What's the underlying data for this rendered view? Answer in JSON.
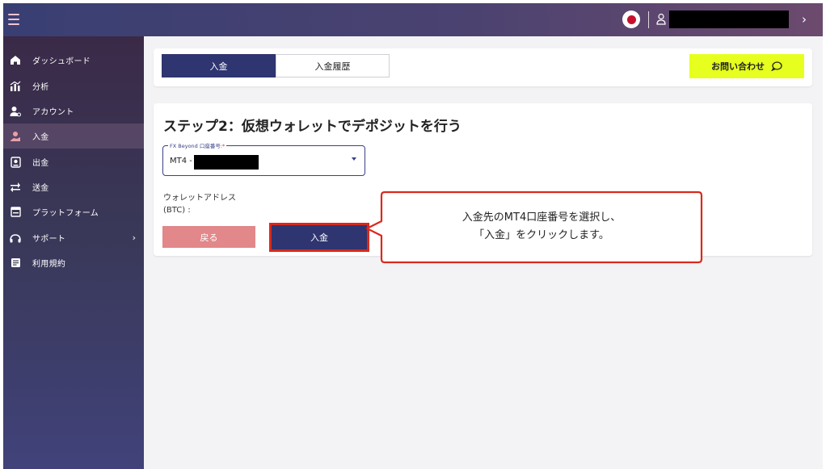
{
  "colors": {
    "navy": "#2e3570",
    "accent_yellow": "#e6ff1e",
    "back_button": "#e2878a",
    "highlight_red": "#d9291c"
  },
  "header": {
    "icons": [
      "menu-icon",
      "japan-flag-icon",
      "user-icon",
      "chevron-right-icon"
    ],
    "chevron": "›"
  },
  "sidebar": {
    "items": [
      {
        "label": "ダッシュボード",
        "icon": "home-icon"
      },
      {
        "label": "分析",
        "icon": "chart-icon"
      },
      {
        "label": "アカウント",
        "icon": "account-icon"
      },
      {
        "label": "入金",
        "icon": "deposit-icon",
        "active": true
      },
      {
        "label": "出金",
        "icon": "withdraw-icon"
      },
      {
        "label": "送金",
        "icon": "transfer-icon"
      },
      {
        "label": "プラットフォーム",
        "icon": "platform-icon"
      },
      {
        "label": "サポート",
        "icon": "support-icon",
        "caret": "›"
      },
      {
        "label": "利用規約",
        "icon": "terms-icon"
      }
    ]
  },
  "tabs": {
    "deposit": "入金",
    "history": "入金履歴",
    "contact": "お問い合わせ"
  },
  "step": {
    "title": "ステップ2：仮想ウォレットでデポジットを行う",
    "account_label": "FX Beyond 口座番号:",
    "required_mark": "*",
    "account_value": "MT4 -",
    "wallet_label_line1": "ウォレットアドレス",
    "wallet_label_line2": "(BTC) :",
    "back_button": "戻る",
    "deposit_button": "入金"
  },
  "callout": {
    "line1": "入金先のMT4口座番号を選択し、",
    "line2": "「入金」をクリックします。"
  }
}
